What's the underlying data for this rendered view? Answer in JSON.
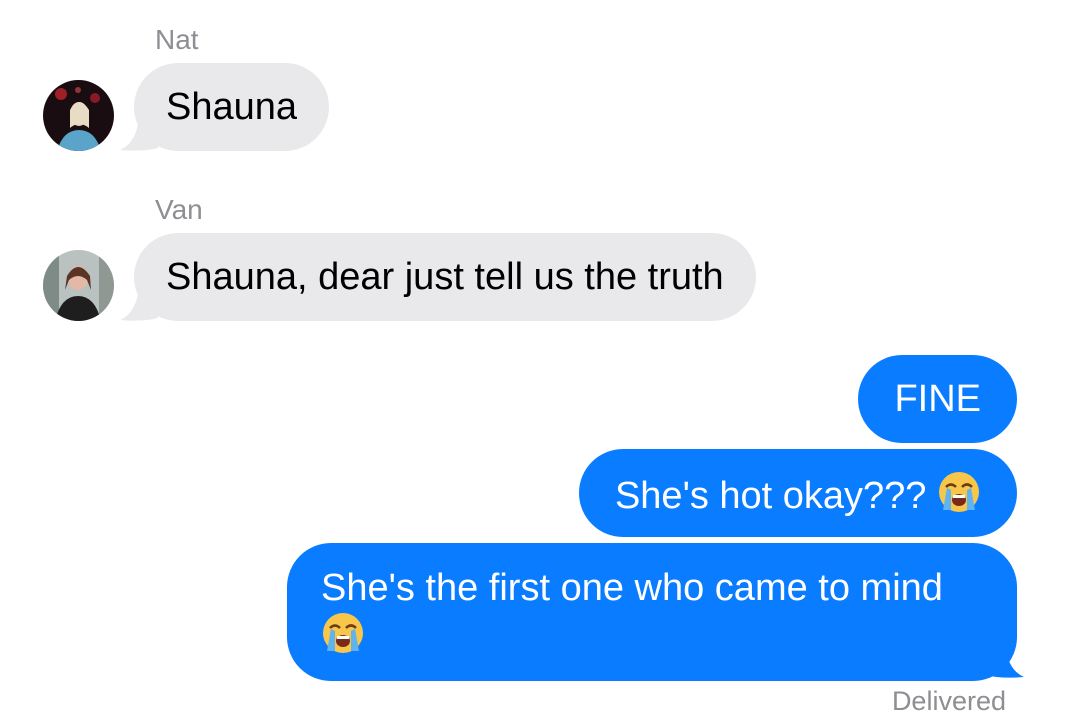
{
  "conversation": {
    "messages": [
      {
        "sender": "Nat",
        "text": "Shauna",
        "direction": "incoming"
      },
      {
        "sender": "Van",
        "text": "Shauna, dear just tell us the truth",
        "direction": "incoming"
      },
      {
        "text": "FINE",
        "direction": "outgoing"
      },
      {
        "text": "She's hot okay???",
        "emoji": "loudly-crying-face-emoji",
        "direction": "outgoing"
      },
      {
        "text": "She's the first one who came to mind",
        "emoji": "loudly-crying-face-emoji",
        "direction": "outgoing"
      }
    ],
    "status": "Delivered"
  },
  "colors": {
    "incoming_bubble": "#e9e9eb",
    "outgoing_bubble": "#0a7cff",
    "secondary_text": "#8e8e93"
  }
}
